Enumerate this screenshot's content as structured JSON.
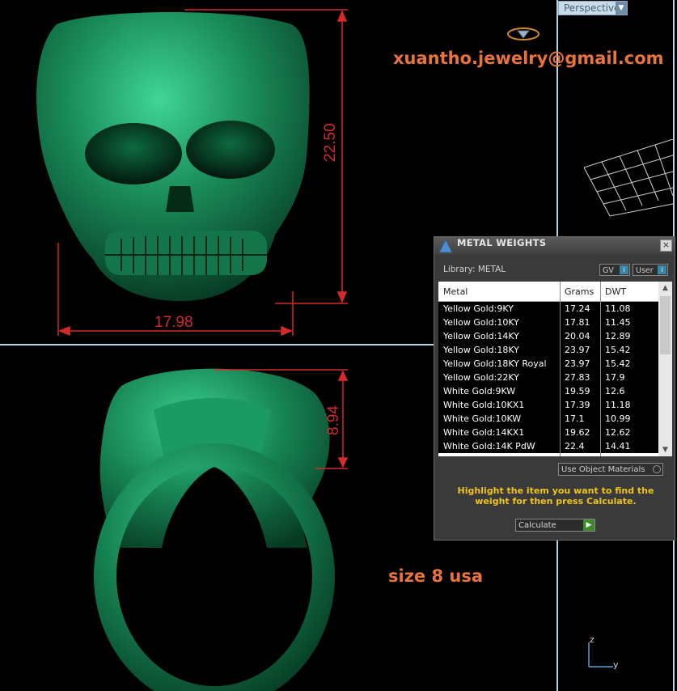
{
  "viewport": {
    "label": "Perspective"
  },
  "watermark": {
    "email": "xuantho.jewelry@gmail.com",
    "size_text": "size 8 usa"
  },
  "dimensions": {
    "height_top": "22.50",
    "width_top": "17.98",
    "height_bottom": "8.94"
  },
  "axis": {
    "z": "z",
    "y": "y"
  },
  "metal_weights": {
    "title": "METAL WEIGHTS",
    "library": "Library: METAL",
    "gv_button": "GV",
    "user_button": "User",
    "headers": [
      "Metal",
      "Grams",
      "DWT"
    ],
    "rows": [
      [
        "Yellow Gold:9KY",
        "17.24",
        "11.08"
      ],
      [
        "Yellow Gold:10KY",
        "17.81",
        "11.45"
      ],
      [
        "Yellow Gold:14KY",
        "20.04",
        "12.89"
      ],
      [
        "Yellow Gold:18KY",
        "23.97",
        "15.42"
      ],
      [
        "Yellow Gold:18KY Royal",
        "23.97",
        "15.42"
      ],
      [
        "Yellow Gold:22KY",
        "27.83",
        "17.9"
      ],
      [
        "White Gold:9KW",
        "19.59",
        "12.6"
      ],
      [
        "White Gold:10KX1",
        "17.39",
        "11.18"
      ],
      [
        "White Gold:10KW",
        "17.1",
        "10.99"
      ],
      [
        "White Gold:14KX1",
        "19.62",
        "12.62"
      ],
      [
        "White Gold:14K PdW",
        "22.4",
        "14.41"
      ]
    ],
    "use_object_materials": "Use Object Materials",
    "hint": "Highlight the item you want to find the weight for then press Calculate.",
    "calculate": "Calculate"
  },
  "colors": {
    "model": "#1e8a5a",
    "dimension": "#d42a2a",
    "accent": "#e8743b",
    "hint": "#f0c419"
  }
}
